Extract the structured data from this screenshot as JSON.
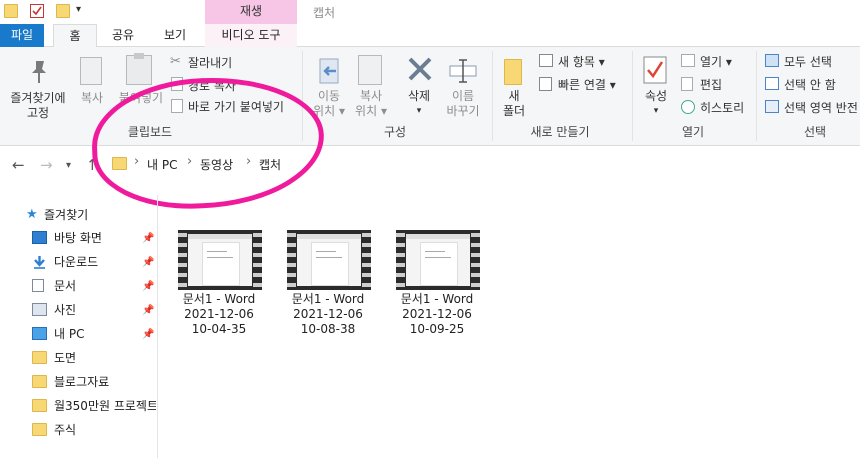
{
  "titlebar": {
    "context_tab": "재생",
    "title": "캡처"
  },
  "tabs": {
    "file": "파일",
    "home": "홈",
    "share": "공유",
    "view": "보기",
    "video_tools": "비디오 도구"
  },
  "ribbon": {
    "clipboard": {
      "label": "클립보드",
      "pin_quick_line1": "즐겨찾기에",
      "pin_quick_line2": "고정",
      "copy": "복사",
      "paste": "붙여넣기",
      "cut": "잘라내기",
      "copy_path": "경로 복사",
      "paste_shortcut": "바로 가기 붙여넣기"
    },
    "organize": {
      "label": "구성",
      "move_line1": "이동",
      "move_line2": "위치",
      "copy_line1": "복사",
      "copy_line2": "위치",
      "delete": "삭제",
      "rename_line1": "이름",
      "rename_line2": "바꾸기"
    },
    "new": {
      "label": "새로 만들기",
      "new_folder_line1": "새",
      "new_folder_line2": "폴더",
      "new_item": "새 항목",
      "easy_access": "빠른 연결"
    },
    "open": {
      "label": "열기",
      "properties": "속성",
      "open": "열기",
      "edit": "편집",
      "history": "히스토리"
    },
    "select": {
      "label": "선택",
      "select_all": "모두 선택",
      "select_none": "선택 안 함",
      "invert": "선택 영역 반전"
    }
  },
  "address": {
    "crumbs": [
      "내 PC",
      "동영상",
      "캡처"
    ]
  },
  "navpane": {
    "quick_access": "즐겨찾기",
    "items": [
      {
        "label": "바탕 화면",
        "pinned": true
      },
      {
        "label": "다운로드",
        "pinned": true
      },
      {
        "label": "문서",
        "pinned": true
      },
      {
        "label": "사진",
        "pinned": true
      },
      {
        "label": "내 PC",
        "pinned": true
      },
      {
        "label": "도면",
        "pinned": false
      },
      {
        "label": "블로그자료",
        "pinned": false
      },
      {
        "label": "월350만원 프로젝트",
        "pinned": false
      },
      {
        "label": "주식",
        "pinned": false
      }
    ]
  },
  "files": [
    {
      "name": "문서1 - Word",
      "date": "2021-12-06",
      "time": "10-04-35"
    },
    {
      "name": "문서1 - Word",
      "date": "2021-12-06",
      "time": "10-08-38"
    },
    {
      "name": "문서1 - Word",
      "date": "2021-12-06",
      "time": "10-09-25"
    }
  ],
  "colors": {
    "file_tab": "#1979ca",
    "context_tab": "#f7c6e6",
    "annotation": "#f01b9c"
  }
}
